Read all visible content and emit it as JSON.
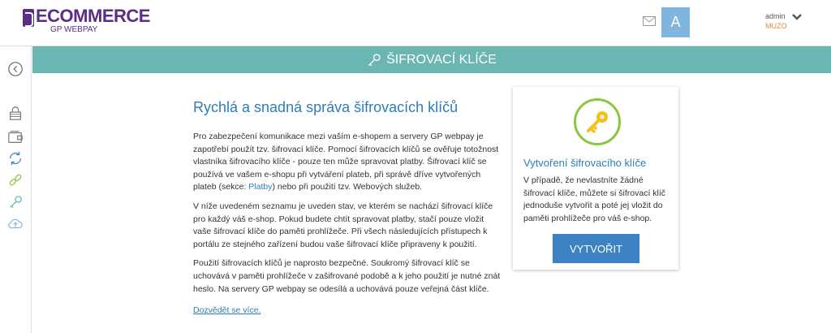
{
  "header": {
    "logo_main": "ECOMMERCE",
    "logo_sub": "GP WEBPAY",
    "avatar_letter": "A",
    "user_name": "admin",
    "user_org": "MUZO"
  },
  "titlebar": {
    "title": "ŠIFROVACÍ KLÍČE"
  },
  "sidebar": {
    "icons": [
      "back-icon",
      "lock-icon",
      "wallet-icon",
      "refresh-icon",
      "link-icon",
      "key-icon",
      "cloud-upload-icon"
    ]
  },
  "content": {
    "heading": "Rychlá a snadná správa šifrovacích klíčů",
    "p1_before_link": "Pro zabezpečení komunikace mezi vaším e-shopem a servery GP webpay je zapotřebí použít tzv. šifrovací klíče. Pomocí šifrovacích klíčů se ověřuje totožnost vlastníka šifrovacího klíče - pouze ten může spravovat platby. Šifrovací klíč se používá ve vašem e-shopu při vytváření plateb, při správě dříve vytvořených plateb (sekce: ",
    "p1_link": "Platby",
    "p1_after_link": ") nebo při použití tzv. Webových služeb.",
    "p2": "V níže uvedeném seznamu je uveden stav, ve kterém se nachází šifrovací klíče pro každý váš e-shop. Pokud budete chtít spravovat platby, stačí pouze vložit vaše šifrovací klíče do paměti prohlížeče. Při všech následujících přístupech k portálu ze stejného zařízení budou vaše šifrovací klíče připraveny k použití.",
    "p3": "Použití šifrovacích klíčů je naprosto bezpečné. Soukromý šifrovací klíč se uchovává v paměti prohlížeče v zašifrované podobě a k jeho použití je nutné znát heslo. Na servery GP webpay se odesílá a uchovává pouze veřejná část klíče.",
    "more_link": "Dozvědět se více."
  },
  "card": {
    "title": "Vytvoření šifrovacího klíče",
    "text": "V případě, že nevlastníte žádné šifrovací klíče, můžete si šifrovací klíč jednoduše vytvořit a poté jej vložit do paměti prohlížeče pro váš e-shop.",
    "button_label": "VYTVOŘIT"
  },
  "colors": {
    "brand": "#5b2d86",
    "titlebar": "#6bb5b3",
    "link": "#2e7db8",
    "button": "#3d83c4",
    "key_ring": "#8cc63f",
    "key": "#f2c21b"
  }
}
